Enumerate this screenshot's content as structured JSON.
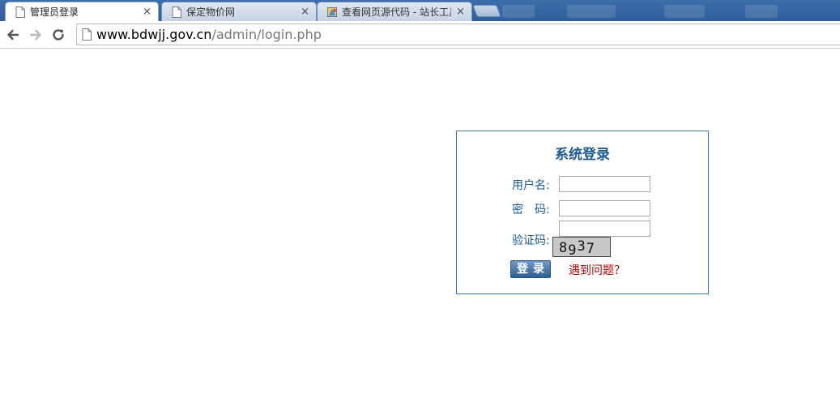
{
  "browser": {
    "tabs": [
      {
        "title": "管理员登录",
        "active": true,
        "icon": "page-icon"
      },
      {
        "title": "保定物价网",
        "active": false,
        "icon": "page-icon"
      },
      {
        "title": "查看网页源代码 - 站长工具",
        "active": false,
        "icon": "site-favicon"
      }
    ],
    "close_glyph": "×",
    "address": {
      "host": "www.bdwjj.gov.cn",
      "path": "/admin/login.php"
    }
  },
  "login": {
    "title": "系统登录",
    "username_label": "用户名:",
    "password_label": "密　码:",
    "captcha_label": "验证码:",
    "username_value": "",
    "password_value": "",
    "captcha_value": "",
    "captcha_text": "8937",
    "submit_label": "登录",
    "help_link": "遇到问题？"
  },
  "colors": {
    "label": "#1d5a8e",
    "panel_border": "#3b79b9",
    "help_link": "#b00000",
    "tabstrip": "#2f5f9c"
  }
}
